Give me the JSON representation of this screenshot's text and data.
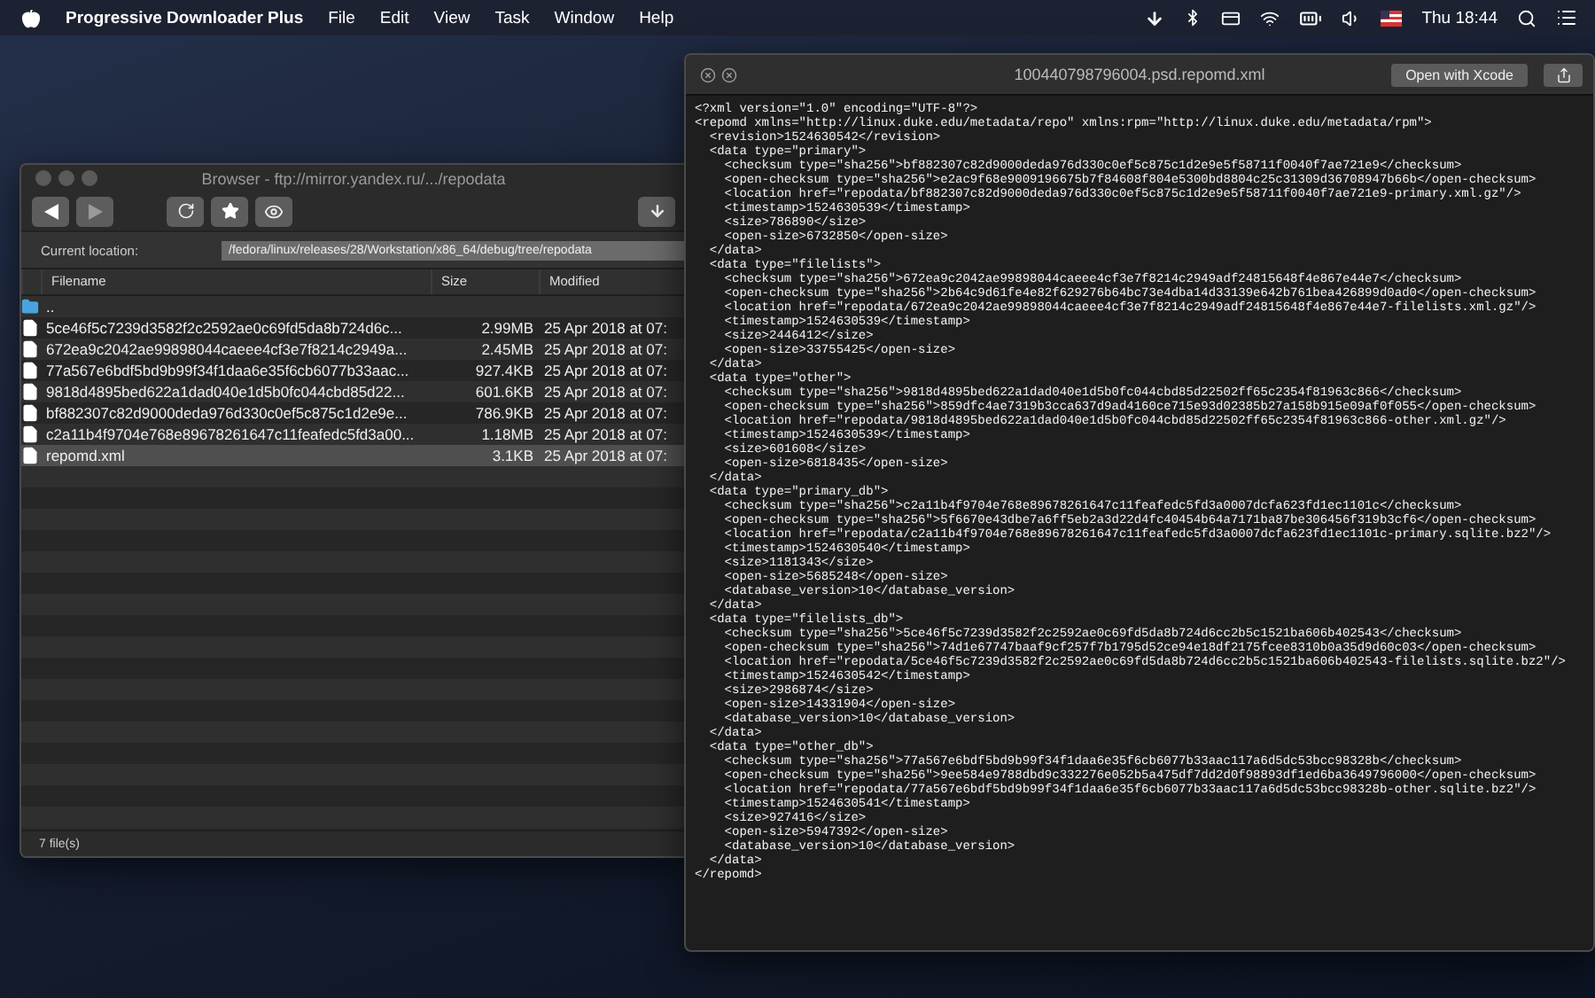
{
  "menubar": {
    "app_name": "Progressive Downloader Plus",
    "menus": [
      "File",
      "Edit",
      "View",
      "Task",
      "Window",
      "Help"
    ],
    "clock": "Thu 18:44"
  },
  "browser": {
    "title": "Browser - ftp://mirror.yandex.ru/.../repodata",
    "location_label": "Current location:",
    "location_value": "/fedora/linux/releases/28/Workstation/x86_64/debug/tree/repodata",
    "columns": [
      "Filename",
      "Size",
      "Modified"
    ],
    "rows": [
      {
        "kind": "folder",
        "name": "..",
        "selected": false
      },
      {
        "kind": "file",
        "name": "5ce46f5c7239d3582f2c2592ae0c69fd5da8b724d6c...",
        "size": "2.99MB",
        "modified": "25 Apr 2018 at 07:",
        "selected": false
      },
      {
        "kind": "file",
        "name": "672ea9c2042ae99898044caeee4cf3e7f8214c2949a...",
        "size": "2.45MB",
        "modified": "25 Apr 2018 at 07:",
        "selected": false
      },
      {
        "kind": "file",
        "name": "77a567e6bdf5bd9b99f34f1daa6e35f6cb6077b33aac...",
        "size": "927.4KB",
        "modified": "25 Apr 2018 at 07:",
        "selected": false
      },
      {
        "kind": "file",
        "name": "9818d4895bed622a1dad040e1d5b0fc044cbd85d22...",
        "size": "601.6KB",
        "modified": "25 Apr 2018 at 07:",
        "selected": false
      },
      {
        "kind": "file",
        "name": "bf882307c82d9000deda976d330c0ef5c875c1d2e9e...",
        "size": "786.9KB",
        "modified": "25 Apr 2018 at 07:",
        "selected": false
      },
      {
        "kind": "file",
        "name": "c2a11b4f9704e768e89678261647c11feafedc5fd3a00...",
        "size": "1.18MB",
        "modified": "25 Apr 2018 at 07:",
        "selected": false
      },
      {
        "kind": "file",
        "name": "repomd.xml",
        "size": "3.1KB",
        "modified": "25 Apr 2018 at 07:",
        "selected": true
      }
    ],
    "status": "7 file(s)"
  },
  "viewer": {
    "title": "100440798796004.psd.repomd.xml",
    "open_button": "Open with Xcode",
    "lines": [
      "<?xml version=\"1.0\" encoding=\"UTF-8\"?>",
      "<repomd xmlns=\"http://linux.duke.edu/metadata/repo\" xmlns:rpm=\"http://linux.duke.edu/metadata/rpm\">",
      "  <revision>1524630542</revision>",
      "  <data type=\"primary\">",
      "    <checksum type=\"sha256\">bf882307c82d9000deda976d330c0ef5c875c1d2e9e5f58711f0040f7ae721e9</checksum>",
      "    <open-checksum type=\"sha256\">e2ac9f68e9009196675b7f84608f804e5300bd8804c25c31309d36708947b66b</open-checksum>",
      "    <location href=\"repodata/bf882307c82d9000deda976d330c0ef5c875c1d2e9e5f58711f0040f7ae721e9-primary.xml.gz\"/>",
      "    <timestamp>1524630539</timestamp>",
      "    <size>786890</size>",
      "    <open-size>6732850</open-size>",
      "  </data>",
      "  <data type=\"filelists\">",
      "    <checksum type=\"sha256\">672ea9c2042ae99898044caeee4cf3e7f8214c2949adf24815648f4e867e44e7</checksum>",
      "    <open-checksum type=\"sha256\">2b64c9d61fe4e82f629276b64bc73e4dba14d33139e642b761bea426899d0ad0</open-checksum>",
      "    <location href=\"repodata/672ea9c2042ae99898044caeee4cf3e7f8214c2949adf24815648f4e867e44e7-filelists.xml.gz\"/>",
      "    <timestamp>1524630539</timestamp>",
      "    <size>2446412</size>",
      "    <open-size>33755425</open-size>",
      "  </data>",
      "  <data type=\"other\">",
      "    <checksum type=\"sha256\">9818d4895bed622a1dad040e1d5b0fc044cbd85d22502ff65c2354f81963c866</checksum>",
      "    <open-checksum type=\"sha256\">859dfc4ae7319b3cca637d9ad4160ce715e93d02385b27a158b915e09af0f055</open-checksum>",
      "    <location href=\"repodata/9818d4895bed622a1dad040e1d5b0fc044cbd85d22502ff65c2354f81963c866-other.xml.gz\"/>",
      "    <timestamp>1524630539</timestamp>",
      "    <size>601608</size>",
      "    <open-size>6818435</open-size>",
      "  </data>",
      "  <data type=\"primary_db\">",
      "    <checksum type=\"sha256\">c2a11b4f9704e768e89678261647c11feafedc5fd3a0007dcfa623fd1ec1101c</checksum>",
      "    <open-checksum type=\"sha256\">5f6670e43dbe7a6ff5eb2a3d22d4fc40454b64a7171ba87be306456f319b3cf6</open-checksum>",
      "    <location href=\"repodata/c2a11b4f9704e768e89678261647c11feafedc5fd3a0007dcfa623fd1ec1101c-primary.sqlite.bz2\"/>",
      "    <timestamp>1524630540</timestamp>",
      "    <size>1181343</size>",
      "    <open-size>5685248</open-size>",
      "    <database_version>10</database_version>",
      "  </data>",
      "  <data type=\"filelists_db\">",
      "    <checksum type=\"sha256\">5ce46f5c7239d3582f2c2592ae0c69fd5da8b724d6cc2b5c1521ba606b402543</checksum>",
      "    <open-checksum type=\"sha256\">74d1e67747baaf9cf257f7b1795d52ce94e18df2175fcee8310b0a35d9d60c03</open-checksum>",
      "    <location href=\"repodata/5ce46f5c7239d3582f2c2592ae0c69fd5da8b724d6cc2b5c1521ba606b402543-filelists.sqlite.bz2\"/>",
      "    <timestamp>1524630542</timestamp>",
      "    <size>2986874</size>",
      "    <open-size>14331904</open-size>",
      "    <database_version>10</database_version>",
      "  </data>",
      "  <data type=\"other_db\">",
      "    <checksum type=\"sha256\">77a567e6bdf5bd9b99f34f1daa6e35f6cb6077b33aac117a6d5dc53bcc98328b</checksum>",
      "    <open-checksum type=\"sha256\">9ee584e9788dbd9c332276e052b5a475df7dd2d0f98893df1ed6ba3649796000</open-checksum>",
      "    <location href=\"repodata/77a567e6bdf5bd9b99f34f1daa6e35f6cb6077b33aac117a6d5dc53bcc98328b-other.sqlite.bz2\"/>",
      "    <timestamp>1524630541</timestamp>",
      "    <size>927416</size>",
      "    <open-size>5947392</open-size>",
      "    <database_version>10</database_version>",
      "  </data>",
      "</repomd>"
    ]
  }
}
